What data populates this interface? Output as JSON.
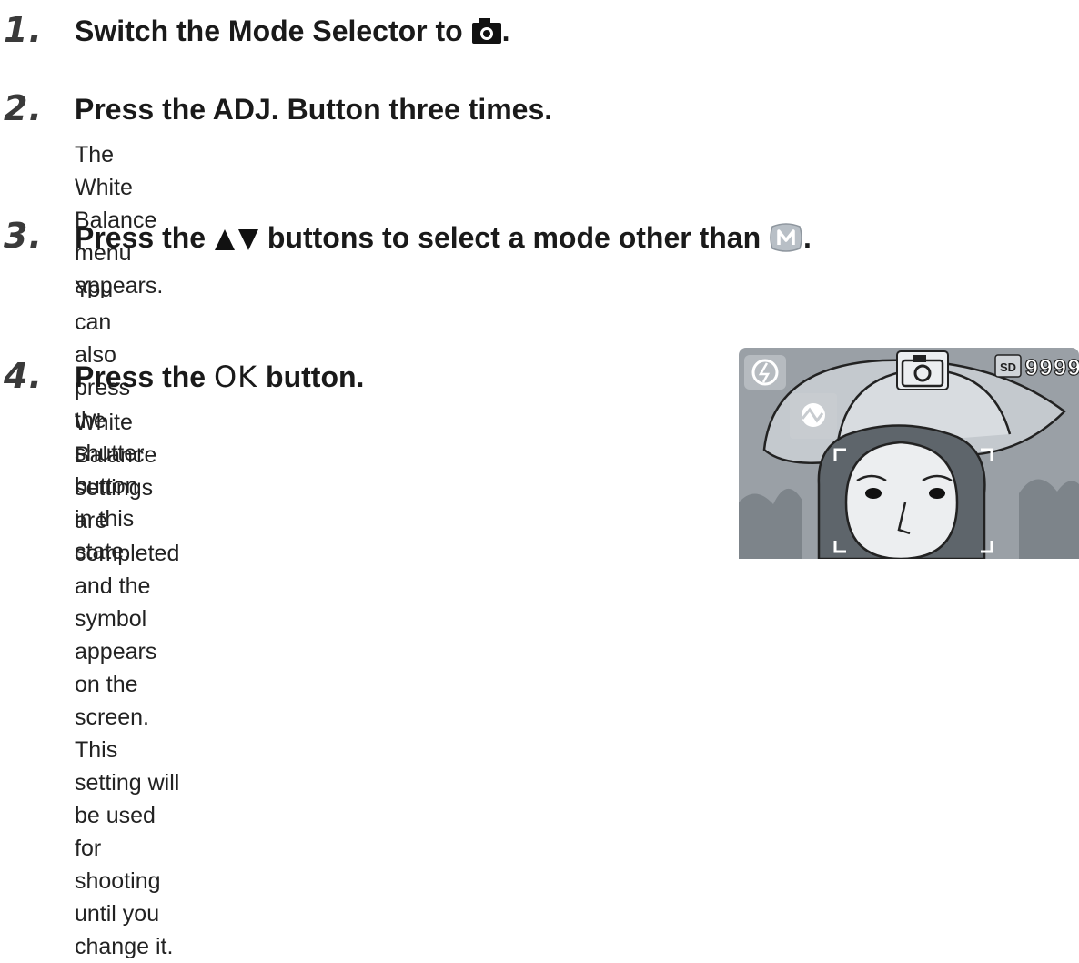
{
  "steps": [
    {
      "number": "1.",
      "heading_before": "Switch the Mode Selector to ",
      "heading_after": ".",
      "heading_icon": "camera-icon"
    },
    {
      "number": "2.",
      "heading": "Press the ADJ. Button three times.",
      "description": "The White Balance menu appears."
    },
    {
      "number": "3.",
      "heading_before": "Press the ",
      "heading_middle": " buttons to select a mode other than ",
      "heading_after": ".",
      "heading_icons": [
        "up-down-arrow-icon",
        "manual-white-balance-icon"
      ],
      "description": "You can also press the shutter button in this state."
    },
    {
      "number": "4.",
      "heading_before": "Press the ",
      "heading_ok": "OK",
      "heading_after": " button.",
      "description_lines": [
        "White Balance settings are completed",
        "and the symbol appears on the screen.",
        "This setting will be used for shooting",
        "until you change it."
      ]
    }
  ],
  "lcd_screen": {
    "counter": "9999",
    "card_label": "SD",
    "icons": [
      "flash-off-icon",
      "camera-mode-icon",
      "white-balance-icon",
      "focus-frame-icon"
    ]
  }
}
